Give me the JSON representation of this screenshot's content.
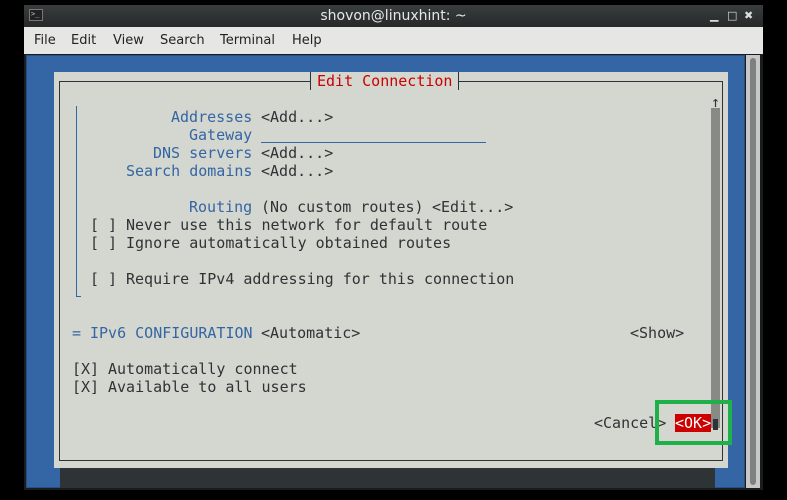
{
  "window": {
    "title": "shovon@linuxhint: ~",
    "app_icon": "terminal-icon",
    "controls": [
      "minimize",
      "maximize",
      "close"
    ]
  },
  "menubar": [
    "File",
    "Edit",
    "View",
    "Search",
    "Terminal",
    "Help"
  ],
  "dialog": {
    "title": "Edit Connection",
    "ipv4_fields": [
      {
        "label": "Addresses",
        "value": "<Add...>"
      },
      {
        "label": "Gateway",
        "value": ""
      },
      {
        "label": "DNS servers",
        "value": "<Add...>"
      },
      {
        "label": "Search domains",
        "value": "<Add...>"
      }
    ],
    "routing": {
      "label": "Routing",
      "value": "(No custom routes)",
      "button": "<Edit...>"
    },
    "ipv4_checkboxes": [
      {
        "mark": "[ ]",
        "label": "Never use this network for default route"
      },
      {
        "mark": "[ ]",
        "label": "Ignore automatically obtained routes"
      },
      {
        "mark": "[ ]",
        "label": "Require IPv4 addressing for this connection"
      }
    ],
    "ipv6": {
      "prefix": "=",
      "label": "IPv6 CONFIGURATION",
      "mode": "<Automatic>",
      "toggle": "<Show>"
    },
    "general_checkboxes": [
      {
        "mark": "[X]",
        "label": "Automatically connect"
      },
      {
        "mark": "[X]",
        "label": "Available to all users"
      }
    ],
    "scroll_up_arrow": "↑",
    "buttons": {
      "cancel": "<Cancel>",
      "ok": "<OK>"
    },
    "highlight_color": "#1fb04a"
  }
}
